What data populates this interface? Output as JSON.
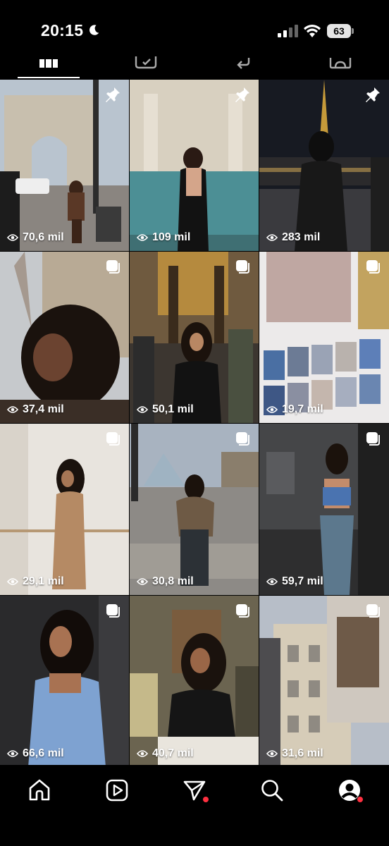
{
  "status_bar": {
    "time": "20:15",
    "battery": "63",
    "icons": [
      "moon-icon",
      "signal-icon",
      "wifi-icon",
      "battery-icon"
    ]
  },
  "tabs": [
    {
      "name": "posts-grid",
      "icon": "grid-icon",
      "active": true
    },
    {
      "name": "reels",
      "icon": "reels-icon",
      "active": false
    },
    {
      "name": "reposts",
      "icon": "repost-icon",
      "active": false
    },
    {
      "name": "tagged",
      "icon": "tagged-icon",
      "active": false
    }
  ],
  "posts": [
    {
      "views": "70,6 mil",
      "badge": "pin-icon"
    },
    {
      "views": "109 mil",
      "badge": "pin-icon"
    },
    {
      "views": "283 mil",
      "badge": "pin-icon"
    },
    {
      "views": "37,4 mil",
      "badge": "multi-icon"
    },
    {
      "views": "50,1 mil",
      "badge": "multi-icon"
    },
    {
      "views": "19,7 mil",
      "badge": "multi-icon"
    },
    {
      "views": "29,1 mil",
      "badge": "multi-icon"
    },
    {
      "views": "30,8 mil",
      "badge": "multi-icon"
    },
    {
      "views": "59,7 mil",
      "badge": "multi-icon"
    },
    {
      "views": "66,6 mil",
      "badge": "multi-icon"
    },
    {
      "views": "40,7 mil",
      "badge": "multi-icon"
    },
    {
      "views": "31,6 mil",
      "badge": "multi-icon"
    }
  ],
  "bottom_nav": [
    {
      "name": "home",
      "icon": "home-icon"
    },
    {
      "name": "reels",
      "icon": "reels-icon"
    },
    {
      "name": "messages",
      "icon": "send-icon",
      "notification": true
    },
    {
      "name": "search",
      "icon": "search-icon"
    },
    {
      "name": "profile",
      "icon": "profile-icon",
      "notification": true
    }
  ],
  "colors": {
    "background": "#000000",
    "notification": "#ff3040"
  }
}
